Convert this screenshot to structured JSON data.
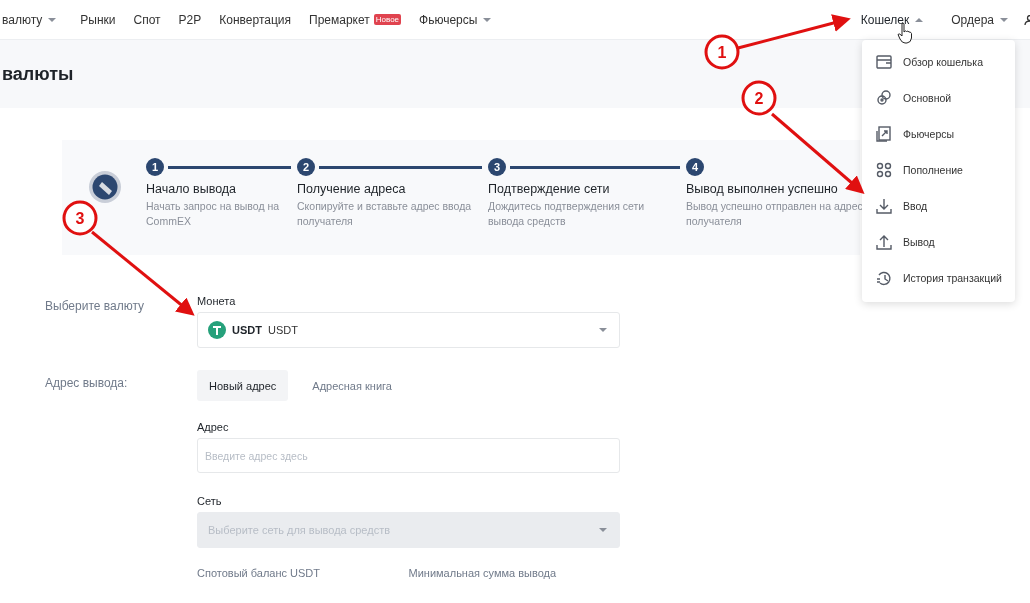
{
  "nav": {
    "left": [
      {
        "label": "валюту",
        "kind": "dropdown",
        "expanded": false
      },
      {
        "label": "Рынки",
        "kind": "link"
      },
      {
        "label": "Спот",
        "kind": "link"
      },
      {
        "label": "P2P",
        "kind": "link"
      },
      {
        "label": "Конвертация",
        "kind": "link"
      },
      {
        "label": "Премаркет",
        "kind": "link",
        "badge": "Новое"
      },
      {
        "label": "Фьючерсы",
        "kind": "dropdown",
        "expanded": false
      }
    ],
    "right": [
      {
        "label": "Кошелек",
        "kind": "dropdown",
        "expanded": true
      },
      {
        "label": "Ордера",
        "kind": "dropdown",
        "expanded": false
      }
    ]
  },
  "page_title": "валюты",
  "steps": [
    {
      "number": "1",
      "title": "Начало вывода",
      "description": "Начать запрос на вывод на CommEX"
    },
    {
      "number": "2",
      "title": "Получение адреса",
      "description": "Скопируйте и вставьте адрес ввода получателя"
    },
    {
      "number": "3",
      "title": "Подтверждение сети",
      "description": "Дождитесь подтверждения сети вывода средств"
    },
    {
      "number": "4",
      "title": "Вывод выполнен успешно",
      "description": "Вывод успешно отправлен на адрес получателя"
    }
  ],
  "form": {
    "currency_label": "Выберите валюту",
    "coin_label": "Монета",
    "coin_symbol": "USDT",
    "coin_name": "USDT",
    "address_section_label": "Адрес вывода:",
    "address_tabs": [
      {
        "label": "Новый адрес",
        "selected": true
      },
      {
        "label": "Адресная книга",
        "selected": false
      }
    ],
    "address_label": "Адрес",
    "address_placeholder": "Введите адрес здесь",
    "network_label": "Сеть",
    "network_placeholder": "Выберите сеть для вывода средств",
    "network_disabled": true,
    "balance_label": "Спотовый баланс USDT",
    "min_label": "Минимальная сумма вывода"
  },
  "wallet_menu": [
    {
      "label": "Обзор кошелька",
      "kind": "wallet"
    },
    {
      "label": "Основной",
      "kind": "coins"
    },
    {
      "label": "Фьючерсы",
      "kind": "futures"
    },
    {
      "label": "Пополнение",
      "kind": "deposit"
    },
    {
      "label": "Ввод",
      "kind": "download"
    },
    {
      "label": "Вывод",
      "kind": "upload"
    },
    {
      "label": "История транзакций",
      "kind": "history"
    }
  ],
  "annotations": [
    {
      "label": "1"
    },
    {
      "label": "2"
    },
    {
      "label": "3"
    }
  ]
}
